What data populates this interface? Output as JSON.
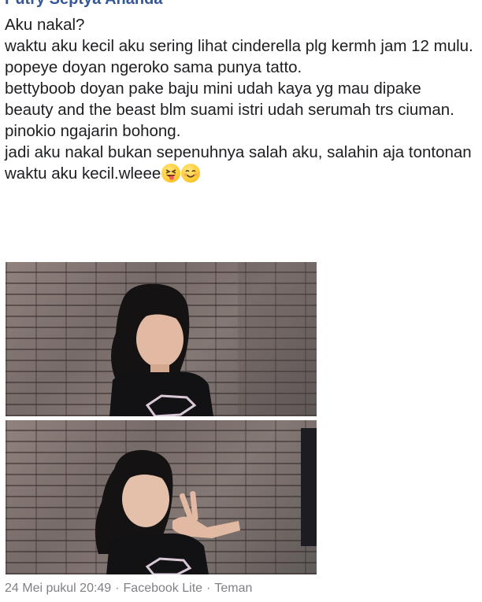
{
  "post": {
    "author": "Putry Septya Ananda",
    "lines": [
      "Aku nakal?",
      "waktu aku kecil aku sering lihat cinderella plg kermh jam 12 mulu.",
      "popeye doyan ngeroko sama punya tatto.",
      "bettyboob doyan pake baju mini udah kaya yg mau dipake",
      "beauty and the beast blm suami istri udah serumah trs ciuman.",
      "pinokio ngajarin bohong.",
      "jadi aku nakal bukan sepenuhnya salah aku, salahin aja tontonan waktu aku kecil.wleee"
    ],
    "emojis": [
      "squinting-tongue-face-icon",
      "smiling-face-icon"
    ]
  },
  "photos": [
    {
      "name": "photo-girl-brick-wall-1"
    },
    {
      "name": "photo-girl-brick-wall-peace-sign"
    }
  ],
  "meta": {
    "date": "24 Mei pukul 20:49",
    "sep1": "·",
    "app": "Facebook Lite",
    "sep2": "·",
    "audience": "Teman"
  }
}
